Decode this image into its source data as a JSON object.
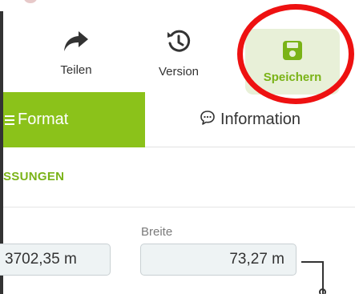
{
  "toolbar": {
    "share_label": "Teilen",
    "share_icon": "share-arrow-icon",
    "version_label": "Version",
    "version_icon": "history-icon",
    "save_label": "Speichern",
    "save_icon": "floppy-disk-icon"
  },
  "tabs": {
    "format_label": "Format",
    "format_icon": "list-lines-icon",
    "info_label": "Information",
    "info_icon": "speech-bubble-icon",
    "active": "format"
  },
  "section": {
    "title": "SSUNGEN"
  },
  "fields": {
    "length_value": "3702,35 m",
    "width_label": "Breite",
    "width_value": "73,27 m"
  },
  "colors": {
    "accent_green": "#8bc21a",
    "save_bg": "#e8f0d8",
    "highlight_red": "#ee1111"
  }
}
